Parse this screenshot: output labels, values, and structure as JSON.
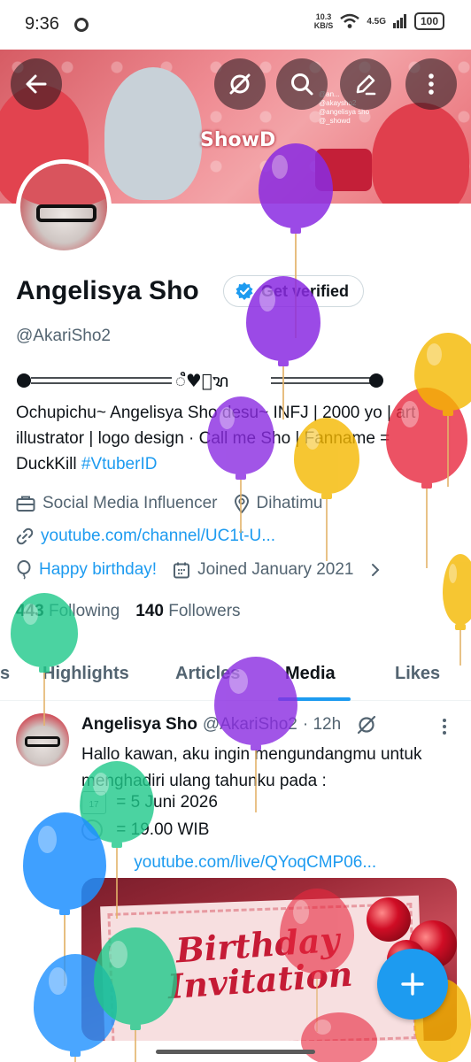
{
  "status_bar": {
    "time": "9:36",
    "net_speed_value": "10.3",
    "net_speed_unit": "KB/S",
    "network_type": "4.5G",
    "battery": "100"
  },
  "banner": {
    "logo_text": "ShowD",
    "tag_lines": [
      "@an...",
      "@akaysho2",
      "@angelisya sho",
      "@_showd"
    ]
  },
  "profile": {
    "display_name": "Angelisya Sho",
    "verified_label": "Get verified",
    "handle": "@AkariSho2",
    "decor_glyph": "ꦶ♥ꦶꦫ",
    "bio_text": "Ochupichu~ Angelisya Sho desu~ INFJ | 2000 yo | art illustrator | logo design · Call me Sho | Fanname = DuckKill ",
    "bio_hashtag": "#VtuberID",
    "category": "Social Media Influencer",
    "location": "Dihatimu",
    "website": "youtube.com/channel/UC1t-U...",
    "birthday": "Happy birthday!",
    "joined": "Joined January 2021",
    "following_count": "443",
    "following_label": "Following",
    "followers_count": "140",
    "followers_label": "Followers"
  },
  "tabs": [
    {
      "label": "s"
    },
    {
      "label": "Highlights"
    },
    {
      "label": "Articles"
    },
    {
      "label": "Media"
    },
    {
      "label": "Likes"
    }
  ],
  "active_tab": "Media",
  "post": {
    "author_name": "Angelisya Sho",
    "author_handle": "@AkariSho2",
    "time": "· 12h",
    "text": "Hallo kawan, aku ingin mengundangmu untuk menghadiri ulang tahunku pada :",
    "date_line": "= 5 Juni 2026",
    "calendar_day": "17",
    "time_line": "= 19.00 WIB",
    "link": "youtube.com/live/QYoqCMP06...",
    "media_title_line1": "Birthday",
    "media_title_line2": "Invitation"
  },
  "fab": {
    "icon": "plus-icon"
  },
  "colors": {
    "accent": "#1d9bf0",
    "text_primary": "#0f1419",
    "text_secondary": "#536471"
  }
}
